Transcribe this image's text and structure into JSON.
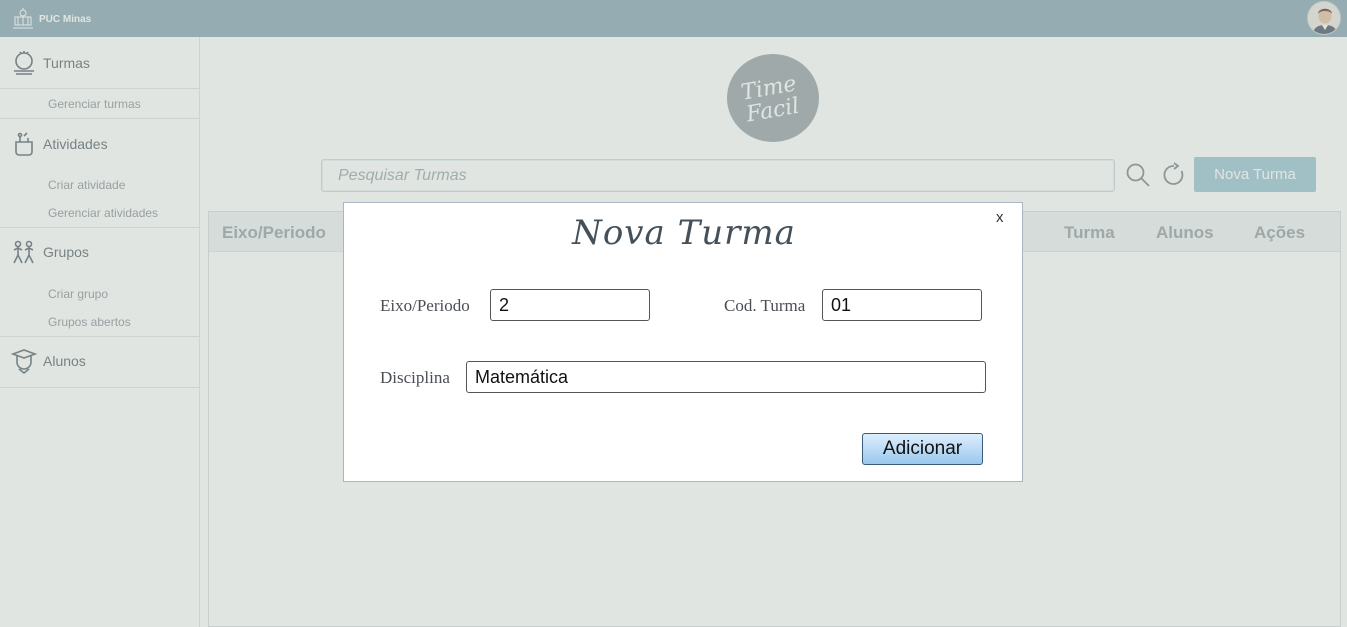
{
  "topbar": {
    "brand_text": "PUC Minas",
    "brand_icon": "puc-crest-icon",
    "avatar_icon": "user-avatar-icon"
  },
  "sidebar": {
    "sections": [
      {
        "label": "Turmas",
        "icon": "class-icon",
        "items": [
          "Gerenciar turmas"
        ]
      },
      {
        "label": "Atividades",
        "icon": "activity-icon",
        "items": [
          "Criar atividade",
          "Gerenciar atividades"
        ]
      },
      {
        "label": "Grupos",
        "icon": "group-icon",
        "items": [
          "Criar grupo",
          "Grupos abertos"
        ]
      },
      {
        "label": "Alunos",
        "icon": "student-icon",
        "items": []
      }
    ]
  },
  "main": {
    "logo_lines": [
      "Time",
      "Facil"
    ],
    "search_placeholder": "Pesquisar Turmas",
    "new_button": "Nova Turma",
    "table_headers": [
      "Eixo/Periodo",
      "Turma",
      "Alunos",
      "Ações"
    ]
  },
  "modal": {
    "title": "Nova Turma",
    "close": "x",
    "eixo_label": "Eixo/Periodo",
    "eixo_value": "2",
    "cod_label": "Cod. Turma",
    "cod_value": "01",
    "disciplina_label": "Disciplina",
    "disciplina_value": "Matemática",
    "submit": "Adicionar"
  },
  "colors": {
    "topbar": "#8aaab5",
    "button": "#9cc7d4",
    "logo_circle": "#9aa3aa"
  }
}
